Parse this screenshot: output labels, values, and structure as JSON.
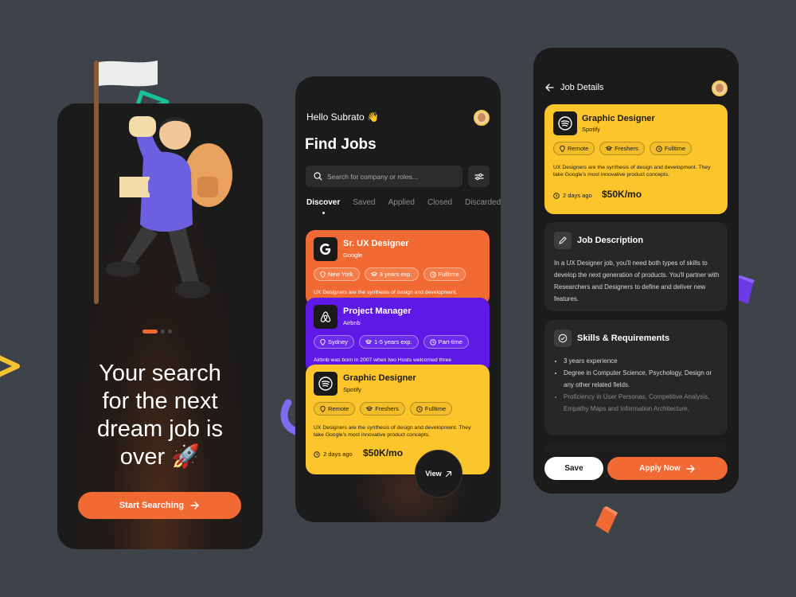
{
  "colors": {
    "background": "#3e434a",
    "phone": "#1b1b1b",
    "accent_orange": "#f26a33",
    "accent_purple": "#5f19e6",
    "accent_yellow": "#fcc52b"
  },
  "onboarding": {
    "headline_lines": [
      "Your search",
      "for the next",
      "dream job is",
      "over 🚀"
    ],
    "pager": {
      "count": 3,
      "active_index": 0
    },
    "cta_label": "Start Searching",
    "cta_icon": "arrow-right-icon"
  },
  "find_jobs": {
    "greeting": "Hello Subrato 👋",
    "title": "Find Jobs",
    "search_placeholder": "Search for company or roles...",
    "tabs": [
      "Discover",
      "Saved",
      "Applied",
      "Closed",
      "Discarded"
    ],
    "active_tab": "Discover",
    "jobs": [
      {
        "title": "Sr. UX Designer",
        "company": "Google",
        "logo": "google-icon",
        "chips": [
          "New York",
          "3 years exp.",
          "Fulltime"
        ],
        "description": "UX Designers are the synthesis of design and development."
      },
      {
        "title": "Project Manager",
        "company": "Airbnb",
        "logo": "airbnb-icon",
        "chips": [
          "Sydney",
          "1-5 years exp.",
          "Part-time"
        ],
        "description": "Airbnb was born in 2007 when two Hosts welcomed three"
      },
      {
        "title": "Graphic Designer",
        "company": "Spotify",
        "logo": "spotify-icon",
        "chips": [
          "Remote",
          "Freshers",
          "Fulltime"
        ],
        "description": "UX Designers are the synthesis of design and development. They take Google's most innovative product concepts.",
        "posted": "2 days ago",
        "salary": "$50K/mo"
      }
    ],
    "view_label": "View"
  },
  "job_details": {
    "header": "Job Details",
    "job": {
      "title": "Graphic Designer",
      "company": "Spotify",
      "chips": [
        "Remote",
        "Freshers",
        "Fulltime"
      ],
      "description": "UX Designers are the synthesis of design and development. They take Google's most innovative product concepts.",
      "posted": "2 days ago",
      "salary": "$50K/mo"
    },
    "description_section": {
      "title": "Job Description",
      "body": "In a UX Designer job, you'll need both types of skills to develop the next generation of products. You'll partner with Researchers and Designers to define and deliver new features."
    },
    "skills_section": {
      "title": "Skills & Requirements",
      "items": [
        "3 years experience",
        "Degree in Computer Science, Psychology, Design or any other related fields.",
        "Proficiency in User Personas, Competitive Analysis, Empathy Maps and Information Architecture."
      ]
    },
    "save_label": "Save",
    "apply_label": "Apply Now"
  }
}
